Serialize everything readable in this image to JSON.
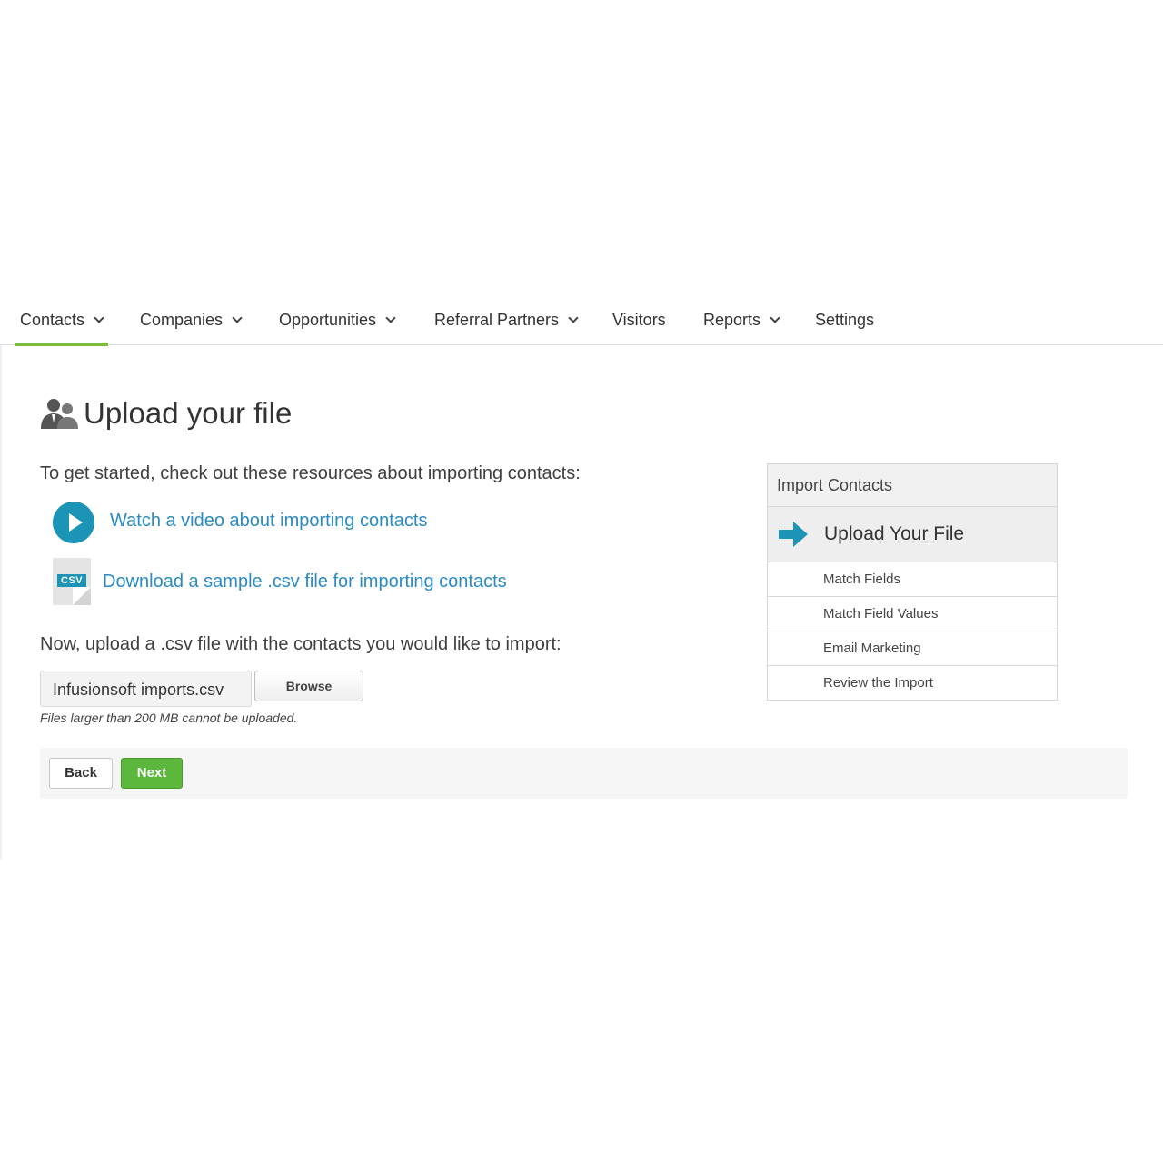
{
  "nav": {
    "items": [
      {
        "label": "Contacts",
        "has_dropdown": true,
        "active": true
      },
      {
        "label": "Companies",
        "has_dropdown": true,
        "active": false
      },
      {
        "label": "Opportunities",
        "has_dropdown": true,
        "active": false
      },
      {
        "label": "Referral Partners",
        "has_dropdown": true,
        "active": false
      },
      {
        "label": "Visitors",
        "has_dropdown": false,
        "active": false
      },
      {
        "label": "Reports",
        "has_dropdown": true,
        "active": false
      },
      {
        "label": "Settings",
        "has_dropdown": false,
        "active": false
      }
    ]
  },
  "page": {
    "title": "Upload your file",
    "title_icon": "contacts-people-icon",
    "intro": "To get started, check out these resources about importing contacts:",
    "resources": {
      "video_link": "Watch a video about importing contacts",
      "csv_link": "Download a sample .csv file for importing contacts",
      "csv_tag": "CSV"
    },
    "upload_label": "Now, upload a .csv file with the contacts you would like to import:",
    "file_value": "Infusionsoft imports.csv",
    "browse_label": "Browse",
    "file_note": "Files larger than 200 MB cannot be uploaded.",
    "back_label": "Back",
    "next_label": "Next"
  },
  "steps": {
    "header": "Import Contacts",
    "current": "Upload Your File",
    "remaining": [
      "Match Fields",
      "Match Field Values",
      "Email Marketing",
      "Review the Import"
    ]
  },
  "colors": {
    "accent_green": "#7dbb3a",
    "next_button": "#5bb83c",
    "link_blue": "#2a8ac4",
    "icon_teal": "#1b94b5"
  }
}
